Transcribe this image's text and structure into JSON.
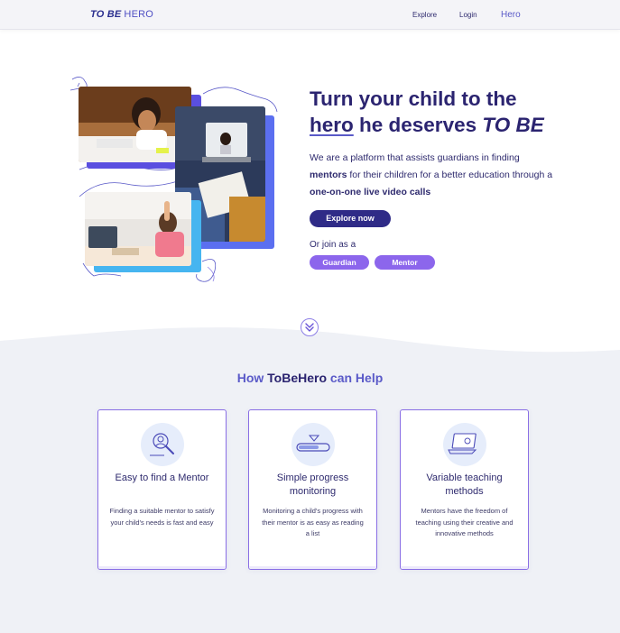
{
  "header": {
    "logo_bold": "TO BE",
    "logo_rest": "HERO",
    "nav": [
      "Explore",
      "Login",
      "Hero"
    ]
  },
  "hero": {
    "headline_line1": "Turn your child to the",
    "headline_word_hero": "hero",
    "headline_mid": " he deserves ",
    "headline_tobe": "TO BE",
    "desc_1": "We are a platform that assists guardians in finding ",
    "desc_bold_1": "mentors",
    "desc_2": " for their children for a better education through a ",
    "desc_bold_2": "one-on-one live video calls",
    "explore_button": "Explore now",
    "join_text": "Or join as a",
    "guardian_button": "Guardian",
    "mentor_button": "Mentor"
  },
  "help": {
    "title_pre": "How ",
    "title_brand": "ToBeHero",
    "title_post": " can Help",
    "cards": [
      {
        "icon": "magnifier-person-icon",
        "title": "Easy to find a Mentor",
        "desc": "Finding a suitable mentor to satisfy your child's needs is fast and easy"
      },
      {
        "icon": "progress-bar-icon",
        "title": "Simple progress monitoring",
        "desc": "Monitoring a child's progress with their mentor is as easy as reading a list"
      },
      {
        "icon": "laptop-video-icon",
        "title": "Variable teaching methods",
        "desc": "Mentors have the freedom of teaching using their creative and innovative methods"
      }
    ]
  },
  "colors": {
    "primary_dark": "#2b2470",
    "accent": "#5a5ac8",
    "pill": "#8c66ec",
    "band": "#eff1f6"
  }
}
